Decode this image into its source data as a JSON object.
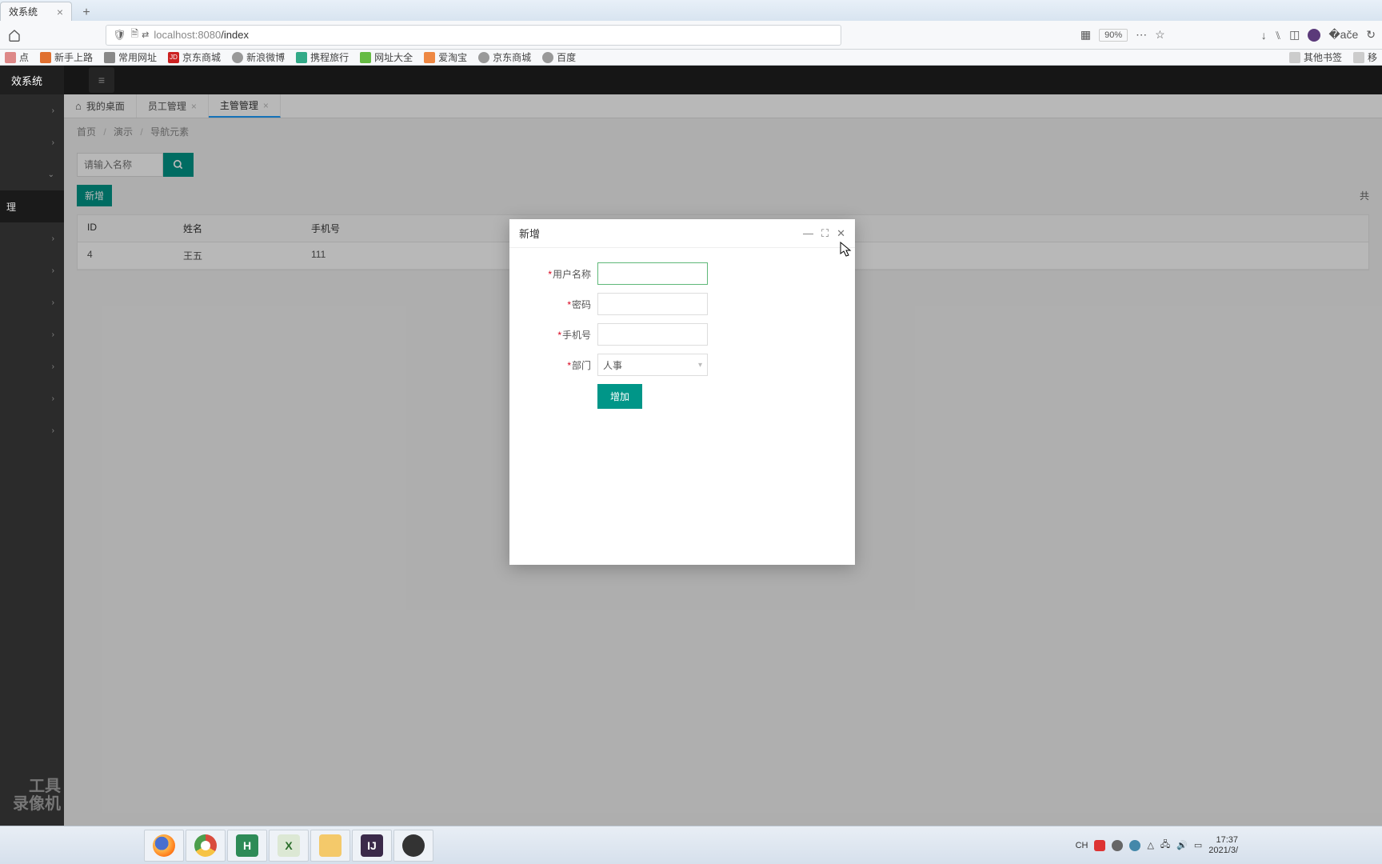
{
  "browser": {
    "tab_title": "效系统",
    "url_host": "localhost",
    "url_port": ":8080",
    "url_path": "/index",
    "zoom": "90%",
    "bookmarks": [
      "点",
      "新手上路",
      "常用网址",
      "京东商城",
      "新浪微博",
      "携程旅行",
      "网址大全",
      "爱淘宝",
      "京东商城",
      "百度"
    ],
    "bookmarks_right": [
      "其他书签",
      "移"
    ]
  },
  "app": {
    "title": "效系统",
    "sidebar_active": "理",
    "side_bottom1": "工具",
    "side_bottom2": "录像机",
    "tabs": [
      {
        "label": "我的桌面",
        "closable": false,
        "home": true
      },
      {
        "label": "员工管理",
        "closable": true
      },
      {
        "label": "主管管理",
        "closable": true,
        "active": true
      }
    ],
    "breadcrumb": [
      "首页",
      "演示",
      "导航元素"
    ],
    "search_placeholder": "请输入名称",
    "add_button": "新增",
    "total_label": "共",
    "table": {
      "headers": [
        "ID",
        "姓名",
        "手机号"
      ],
      "rows": [
        {
          "id": "4",
          "name": "王五",
          "phone": "111"
        }
      ]
    }
  },
  "dialog": {
    "title": "新增",
    "fields": {
      "username_label": "用户名称",
      "password_label": "密码",
      "phone_label": "手机号",
      "dept_label": "部门",
      "dept_value": "人事"
    },
    "submit": "增加"
  },
  "taskbar": {
    "ime": "CH",
    "time": "17:37",
    "date": "2021/3/"
  }
}
